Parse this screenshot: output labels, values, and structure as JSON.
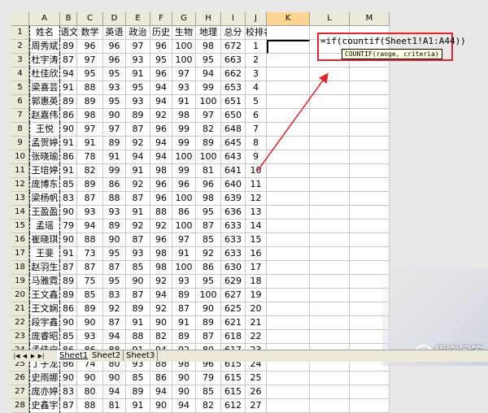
{
  "columns": [
    "A",
    "B",
    "C",
    "D",
    "E",
    "F",
    "G",
    "H",
    "I",
    "J",
    "K",
    "L",
    "M"
  ],
  "header_row": [
    "姓名",
    "语文",
    "数学",
    "英语",
    "政治",
    "历史",
    "生物",
    "地理",
    "总分",
    "校排名"
  ],
  "rows": [
    [
      "周秀斌",
      "89",
      "96",
      "96",
      "97",
      "96",
      "100",
      "98",
      "672",
      "1"
    ],
    [
      "杜宇涛",
      "87",
      "97",
      "96",
      "93",
      "95",
      "100",
      "95",
      "663",
      "2"
    ],
    [
      "杜佳欣",
      "94",
      "95",
      "95",
      "91",
      "96",
      "97",
      "94",
      "662",
      "3"
    ],
    [
      "梁喜芸",
      "91",
      "88",
      "93",
      "95",
      "94",
      "93",
      "99",
      "653",
      "4"
    ],
    [
      "郭惠英",
      "89",
      "89",
      "95",
      "93",
      "94",
      "91",
      "100",
      "651",
      "5"
    ],
    [
      "赵嘉伟",
      "86",
      "98",
      "90",
      "89",
      "92",
      "98",
      "97",
      "650",
      "6"
    ],
    [
      "王悦",
      "90",
      "97",
      "97",
      "87",
      "96",
      "99",
      "82",
      "648",
      "7"
    ],
    [
      "孟贺婷",
      "91",
      "91",
      "89",
      "92",
      "94",
      "99",
      "89",
      "645",
      "8"
    ],
    [
      "张晓瑜",
      "86",
      "78",
      "91",
      "94",
      "94",
      "100",
      "100",
      "643",
      "9"
    ],
    [
      "王培婷",
      "91",
      "82",
      "99",
      "91",
      "98",
      "99",
      "81",
      "641",
      "10"
    ],
    [
      "庞博东",
      "85",
      "89",
      "86",
      "92",
      "96",
      "96",
      "96",
      "640",
      "11"
    ],
    [
      "梁杨帆",
      "83",
      "87",
      "88",
      "87",
      "96",
      "100",
      "98",
      "639",
      "12"
    ],
    [
      "王盈盈",
      "90",
      "93",
      "93",
      "91",
      "88",
      "86",
      "95",
      "636",
      "13"
    ],
    [
      "孟瑶",
      "79",
      "94",
      "89",
      "92",
      "92",
      "100",
      "87",
      "633",
      "14"
    ],
    [
      "崔晓琪",
      "90",
      "88",
      "90",
      "87",
      "96",
      "97",
      "85",
      "633",
      "15"
    ],
    [
      "王斐",
      "91",
      "73",
      "95",
      "93",
      "98",
      "91",
      "92",
      "633",
      "16"
    ],
    [
      "赵羽生",
      "87",
      "87",
      "87",
      "85",
      "98",
      "100",
      "86",
      "630",
      "17"
    ],
    [
      "马雅霓",
      "89",
      "75",
      "95",
      "90",
      "92",
      "93",
      "95",
      "629",
      "18"
    ],
    [
      "王文鑫",
      "89",
      "85",
      "83",
      "87",
      "94",
      "89",
      "100",
      "627",
      "19"
    ],
    [
      "王文娴",
      "86",
      "89",
      "92",
      "89",
      "92",
      "87",
      "90",
      "625",
      "20"
    ],
    [
      "段宇鑫",
      "90",
      "90",
      "87",
      "91",
      "90",
      "91",
      "89",
      "621",
      "21"
    ],
    [
      "庞睿昭",
      "85",
      "93",
      "94",
      "88",
      "82",
      "89",
      "87",
      "618",
      "22"
    ],
    [
      "孟佳宁",
      "86",
      "86",
      "88",
      "91",
      "94",
      "92",
      "80",
      "617",
      "23"
    ],
    [
      "丁子龙",
      "86",
      "74",
      "80",
      "93",
      "88",
      "98",
      "96",
      "615",
      "24"
    ],
    [
      "史雨娜",
      "90",
      "90",
      "90",
      "85",
      "86",
      "90",
      "79",
      "615",
      "25"
    ],
    [
      "庞亦婷",
      "83",
      "80",
      "94",
      "89",
      "94",
      "90",
      "85",
      "615",
      "26"
    ],
    [
      "史鑫宇",
      "87",
      "88",
      "81",
      "91",
      "90",
      "94",
      "82",
      "612",
      "27"
    ]
  ],
  "formula": {
    "text": "=if(countif(Sheet1!A1:A44))",
    "tooltip": "COUNTIF(range, criteria)"
  },
  "tabs": [
    "Sheet1",
    "Sheet2",
    "Sheet3"
  ],
  "active_tab": "Sheet1",
  "watermark": "悟空问答",
  "colors": {
    "highlight": "#e4232f",
    "header_bg": "#ece9d8",
    "selected_header": "#ffd591"
  }
}
